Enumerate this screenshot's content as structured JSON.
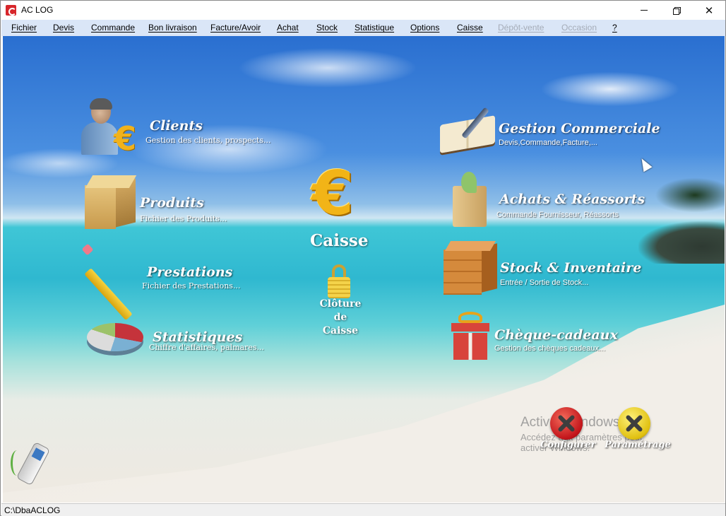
{
  "window": {
    "title": "AC LOG",
    "controls": {
      "minimize_icon": "minimize-icon",
      "maximize_icon": "restore-icon",
      "close_label": "✕"
    }
  },
  "menu": {
    "items": [
      {
        "label": "Fichier",
        "enabled": true
      },
      {
        "label": "Devis",
        "enabled": true
      },
      {
        "label": "Commande",
        "enabled": true
      },
      {
        "label": "Bon livraison",
        "enabled": true
      },
      {
        "label": "Facture/Avoir",
        "enabled": true
      },
      {
        "label": "Achat",
        "enabled": true
      },
      {
        "label": "Stock",
        "enabled": true
      },
      {
        "label": "Statistique",
        "enabled": true
      },
      {
        "label": "Options",
        "enabled": true
      },
      {
        "label": "Caisse",
        "enabled": true
      },
      {
        "label": "Dépôt-vente",
        "enabled": false
      },
      {
        "label": "Occasion",
        "enabled": false
      },
      {
        "label": "?",
        "enabled": true
      }
    ]
  },
  "tiles": {
    "clients": {
      "title": "Clients",
      "subtitle": "Gestion des clients, prospects...",
      "icon": "client-euro-icon"
    },
    "produits": {
      "title": "Produits",
      "subtitle": "Fichier des Produits...",
      "icon": "box-icon"
    },
    "prestations": {
      "title": "Prestations",
      "subtitle": "Fichier des Prestations...",
      "icon": "pencil-icon"
    },
    "statistiques": {
      "title": "Statistiques",
      "subtitle": "Chiffre d'affaires, palmares...",
      "icon": "pie-chart-icon"
    },
    "gestion": {
      "title": "Gestion Commerciale",
      "subtitle": "Devis,Commande,Facture,...",
      "icon": "book-pen-icon"
    },
    "achats": {
      "title": "Achats & Réassorts",
      "subtitle": "Commande Fournisseur, Réassorts",
      "icon": "shopping-bag-icon"
    },
    "stock": {
      "title": "Stock & Inventaire",
      "subtitle": "Entrée / Sortie de Stock...",
      "icon": "crate-icon"
    },
    "cheques": {
      "title": "Chèque-cadeaux",
      "subtitle": "Gestion des chèques cadeaux...",
      "icon": "gift-icon"
    }
  },
  "caisse": {
    "symbol": "€",
    "label": "Caisse",
    "cloture_line1": "Clôture de",
    "cloture_line2": "Caisse"
  },
  "tools": {
    "configurer": "Configurer",
    "parametrage": "Paramétrage"
  },
  "watermark": {
    "title": "Activer Windows",
    "text": "Accédez aux paramètres pour activer Windows."
  },
  "statusbar": {
    "path": "C:\\DbaACLOG"
  }
}
